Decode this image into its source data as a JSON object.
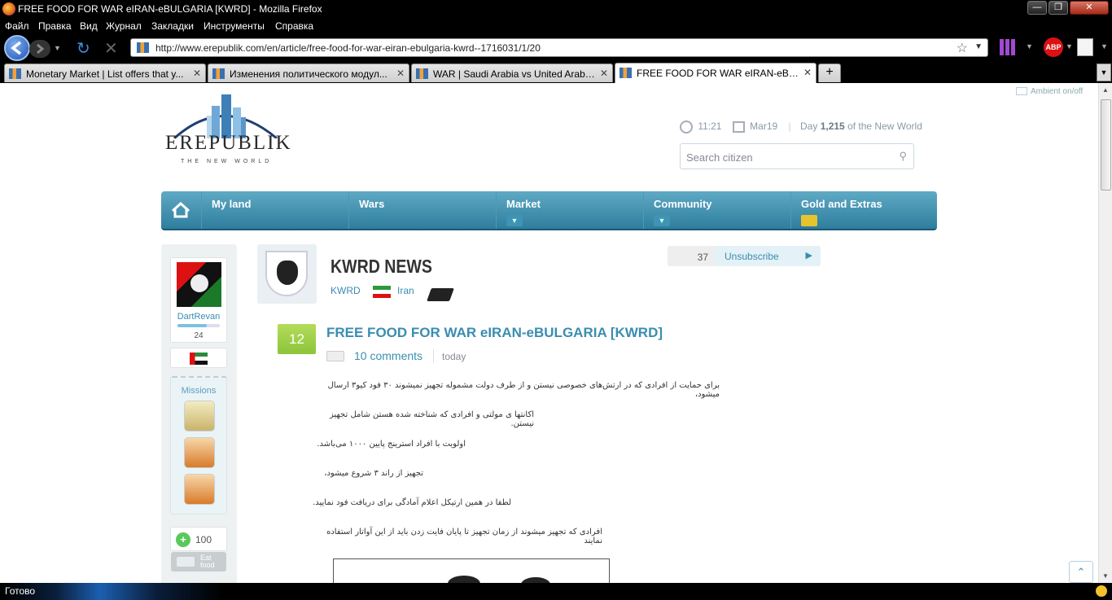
{
  "window": {
    "title": "FREE FOOD FOR WAR eIRAN-eBULGARIA [KWRD] - Mozilla Firefox"
  },
  "menu": [
    "Файл",
    "Правка",
    "Вид",
    "Журнал",
    "Закладки",
    "Инструменты",
    "Справка"
  ],
  "url": "http://www.erepublik.com/en/article/free-food-for-war-eiran-ebulgaria-kwrd--1716031/1/20",
  "tabs": [
    {
      "label": "Monetary Market | List offers that y..."
    },
    {
      "label": "Изменения политического модул..."
    },
    {
      "label": "WAR | Saudi Arabia vs United Arab ..."
    },
    {
      "label": "FREE FOOD FOR WAR eIRAN-eBU..."
    }
  ],
  "status": "Готово",
  "ambient": "Ambient on/off",
  "logo": {
    "name": "EREPUBLIK",
    "tagline": "THE NEW WORLD"
  },
  "header": {
    "time": "11:21",
    "date": "Mar19",
    "day_prefix": "Day",
    "day_number": "1,215",
    "day_suffix": "of the New World",
    "search_placeholder": "Search citizen"
  },
  "nav": [
    "My land",
    "Wars",
    "Market",
    "Community",
    "Gold and Extras"
  ],
  "sidebar": {
    "username": "DartRevan",
    "level": "24",
    "missions_label": "Missions",
    "health": "100",
    "eat_label": "Eat food"
  },
  "newspaper": {
    "name": "KWRD NEWS",
    "owner": "KWRD",
    "country": "Iran",
    "subscribers": "37",
    "unsubscribe": "Unsubscribe"
  },
  "article": {
    "votes": "12",
    "title": "FREE FOOD FOR WAR eIRAN-eBULGARIA [KWRD]",
    "comments": "10 comments",
    "date": "today",
    "paragraphs": [
      "برای حمایت از افرادی که در ارتش‌های خصوصی نیستن و از طرف دولت مشموله تجهیز نمیشوند ۳۰ فود کیو۳ ارسال میشود،",
      "اکانتها ی مولتی و افرادی که شناخته شده هستن شامل تجهیز نیستن.",
      "اولویت با افراد استرینج پایین ۱۰۰۰ می‌باشد.",
      "تجهیز از راند ۳ شروع میشود،",
      "لطفا در همین ارتیکل اعلام آمادگی برای دریافت فود نمایید.",
      "افرادی که تجهیز میشوند از زمان تجهیز تا پایان فایت زدن باید از این آواتار استفاده نمایند"
    ]
  }
}
